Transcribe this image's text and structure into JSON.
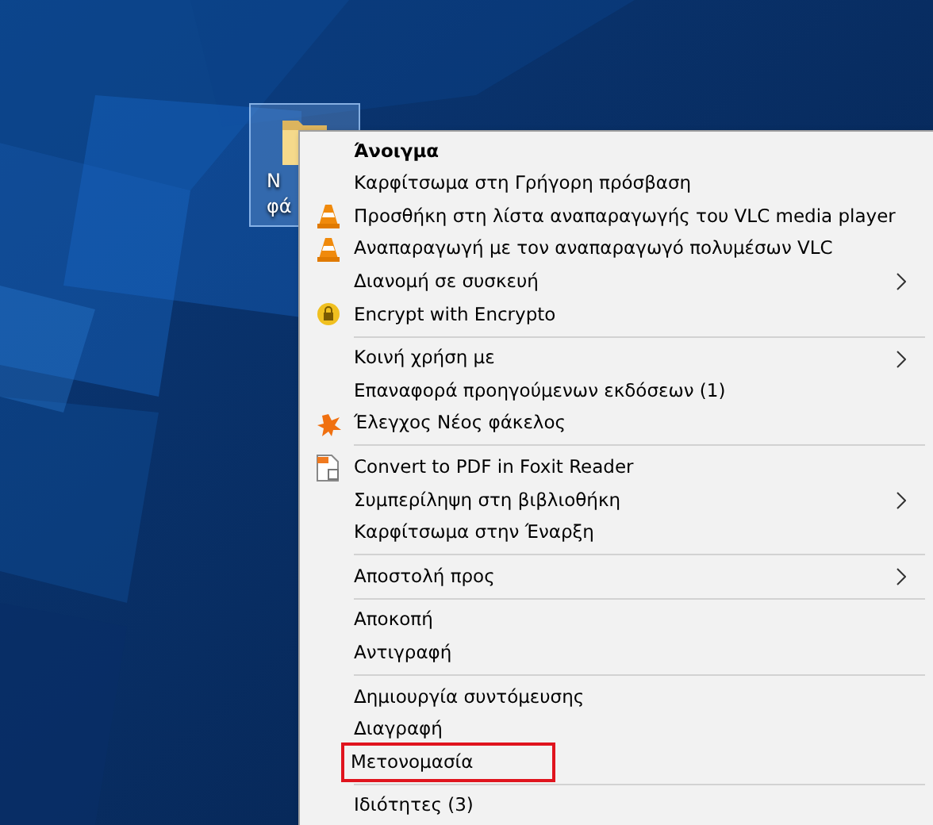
{
  "desktop_icon": {
    "label_lines": [
      "N",
      "φά"
    ],
    "selected": true
  },
  "context_menu": {
    "groups": [
      {
        "items": [
          {
            "label": "Άνοιγμα",
            "kind": "plain",
            "default": true,
            "submenu": false,
            "annotated": false
          },
          {
            "label": "Καρφίτσωμα στη Γρήγορη πρόσβαση",
            "kind": "plain",
            "default": false,
            "submenu": false,
            "annotated": false
          },
          {
            "label": "Προσθήκη στη λίστα αναπαραγωγής του VLC media player",
            "kind": "cone",
            "default": false,
            "submenu": false,
            "annotated": false
          },
          {
            "label": "Αναπαραγωγή με τον αναπαραγωγό πολυμέσων VLC",
            "kind": "cone",
            "default": false,
            "submenu": false,
            "annotated": false
          },
          {
            "label": "Διανομή σε συσκευή",
            "kind": "plain",
            "default": false,
            "submenu": true,
            "annotated": false
          },
          {
            "label": "Encrypt with Encrypto",
            "kind": "coin",
            "default": false,
            "submenu": false,
            "annotated": false
          }
        ]
      },
      {
        "items": [
          {
            "label": "Κοινή χρήση με",
            "kind": "plain",
            "default": false,
            "submenu": true,
            "annotated": false
          },
          {
            "label": "Επαναφορά προηγούμενων εκδόσεων (1)",
            "kind": "plain",
            "default": false,
            "submenu": false,
            "annotated": false
          },
          {
            "label": "Έλεγχος Νέος φάκελος",
            "kind": "splat",
            "default": false,
            "submenu": false,
            "annotated": false
          }
        ]
      },
      {
        "items": [
          {
            "label": "Convert to PDF in Foxit Reader",
            "kind": "document",
            "default": false,
            "submenu": false,
            "annotated": false
          },
          {
            "label": "Συμπερίληψη στη βιβλιοθήκη",
            "kind": "plain",
            "default": false,
            "submenu": true,
            "annotated": false
          },
          {
            "label": "Καρφίτσωμα στην Έναρξη",
            "kind": "plain",
            "default": false,
            "submenu": false,
            "annotated": false
          }
        ]
      },
      {
        "items": [
          {
            "label": "Αποστολή προς",
            "kind": "plain",
            "default": false,
            "submenu": true,
            "annotated": false
          }
        ]
      },
      {
        "items": [
          {
            "label": "Αποκοπή",
            "kind": "plain",
            "default": false,
            "submenu": false,
            "annotated": false
          },
          {
            "label": "Αντιγραφή",
            "kind": "plain",
            "default": false,
            "submenu": false,
            "annotated": false
          }
        ]
      },
      {
        "items": [
          {
            "label": "Δημιουργία συντόμευσης",
            "kind": "plain",
            "default": false,
            "submenu": false,
            "annotated": false
          },
          {
            "label": "Διαγραφή",
            "kind": "plain",
            "default": false,
            "submenu": false,
            "annotated": false
          },
          {
            "label": "Μετονομασία",
            "kind": "plain",
            "default": false,
            "submenu": false,
            "annotated": true
          }
        ]
      },
      {
        "items": [
          {
            "label": "Ιδιότητες (3)",
            "kind": "plain",
            "default": false,
            "submenu": false,
            "annotated": false
          }
        ]
      }
    ]
  }
}
